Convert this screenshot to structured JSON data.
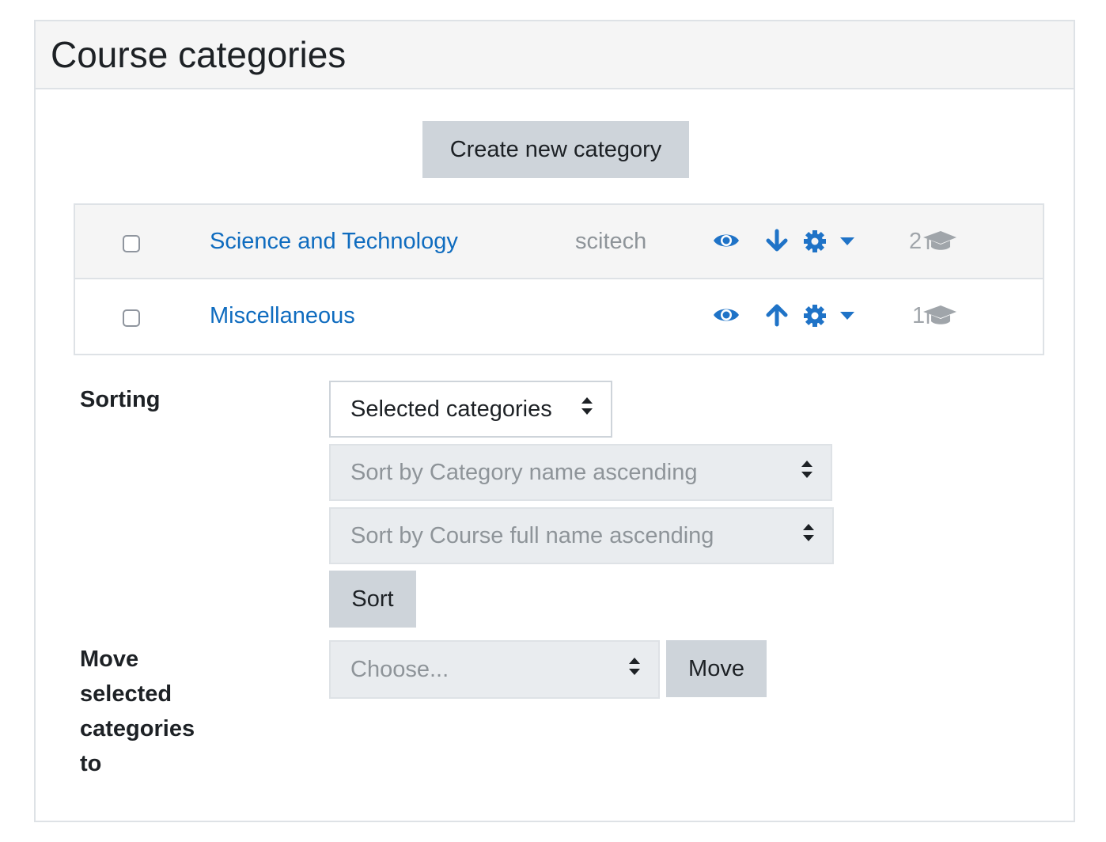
{
  "panel": {
    "title": "Course categories",
    "create_button": "Create new category"
  },
  "categories": [
    {
      "name": "Science and Technology",
      "idnumber": "scitech",
      "visibility_icon": "eye-icon",
      "move_icon": "arrow-down-icon",
      "settings_icon": "gear-icon",
      "menu_icon": "caret-down-icon",
      "course_count": "2",
      "course_icon": "graduation-cap-icon"
    },
    {
      "name": "Miscellaneous",
      "idnumber": "",
      "visibility_icon": "eye-icon",
      "move_icon": "arrow-up-icon",
      "settings_icon": "gear-icon",
      "menu_icon": "caret-down-icon",
      "course_count": "1",
      "course_icon": "graduation-cap-icon"
    }
  ],
  "sorting": {
    "label": "Sorting",
    "scope_select": "Selected categories",
    "category_sort_select": "Sort by Category name ascending",
    "course_sort_select": "Sort by Course full name ascending",
    "sort_button": "Sort"
  },
  "move": {
    "label": "Move selected categories to",
    "select_placeholder": "Choose...",
    "move_button": "Move"
  },
  "colors": {
    "link": "#0f6cbf",
    "button_bg": "#ced4da",
    "header_bg": "#f5f5f5",
    "disabled_bg": "#e9ecef"
  }
}
